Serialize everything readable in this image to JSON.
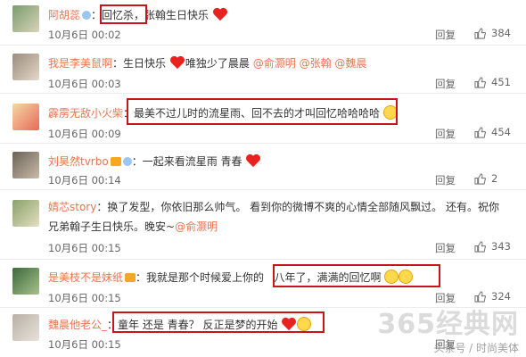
{
  "comments": [
    {
      "user": "阿胡蕊",
      "text": "回忆杀，张翰生日快乐",
      "time": "10月6日 00:02",
      "reply": "回复",
      "likes": "384"
    },
    {
      "user": "我是李美鼠啊",
      "text": "生日快乐",
      "text2": "唯独少了晨晨",
      "mentions": [
        "@俞灏明",
        "@张翰",
        "@魏晨"
      ],
      "time": "10月6日 00:03",
      "reply": "回复",
      "likes": "451"
    },
    {
      "user": "霹雳无敌小火柴",
      "text": "最美不过儿时的流星雨、回不去的才叫回忆哈哈哈哈",
      "time": "10月6日 00:09",
      "reply": "回复",
      "likes": "454"
    },
    {
      "user": "刘昊然tvrbo",
      "text": "一起来看流星雨 青春",
      "time": "10月6日 00:14",
      "reply": "回复",
      "likes": "2"
    },
    {
      "user": "婧芯story",
      "text": "换了发型，你依旧那么帅气。 看到你的微博不爽的心情全部随风飘过。    还有。祝你",
      "text_cont": "兄弟翰子生日快乐。晚安~",
      "mention": "@俞灏明",
      "time": "10月6日 00:15",
      "reply": "回复",
      "likes": "343"
    },
    {
      "user": "是美枝不是妹纸",
      "text": "我就是那个时候爱上你的",
      "text2": "八年了，满满的回忆啊",
      "time": "10月6日 00:15",
      "reply": "回复",
      "likes": "324"
    },
    {
      "user": "魏晨他老公_",
      "text": "童年 还是 青春？ 反正是梦的开始",
      "time": "10月6日 00:15",
      "reply": "回复",
      "likes": ""
    }
  ],
  "watermark": "365经典网",
  "watermark_sub": "头条号 / 时尚美体",
  "colors": {
    "username": "#eb7350",
    "highlight_box": "#c8141b"
  },
  "icons": [
    "thumbs-up-icon",
    "heart-icon",
    "emoji-icon",
    "verified-badge-icon",
    "vip-crown-icon"
  ]
}
